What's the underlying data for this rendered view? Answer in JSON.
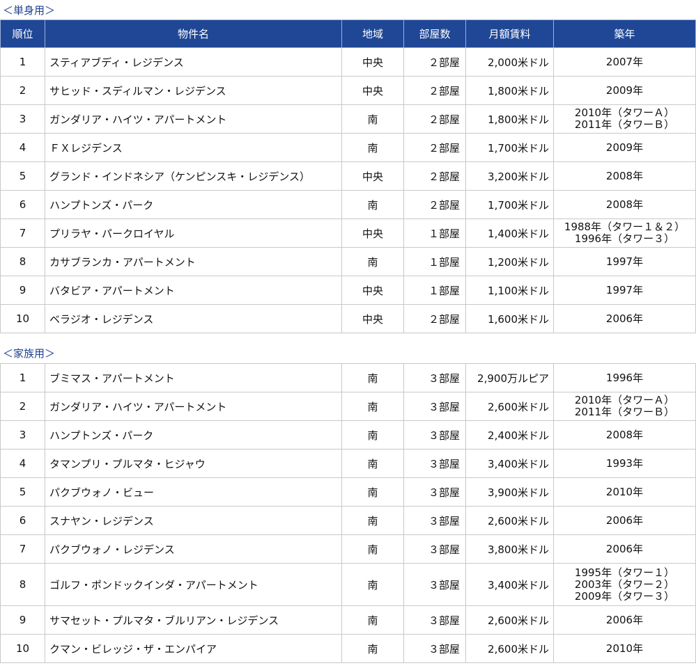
{
  "single": {
    "title": "＜単身用＞",
    "headers": {
      "rank": "順位",
      "name": "物件名",
      "region": "地域",
      "rooms": "部屋数",
      "rent": "月額賃料",
      "year": "築年"
    },
    "rows": [
      {
        "rank": "1",
        "name": "スティアブディ・レジデンス",
        "region": "中央",
        "rooms": "２部屋",
        "rent": "2,000米ドル",
        "year": [
          "2007年"
        ]
      },
      {
        "rank": "2",
        "name": "サヒッド・スディルマン・レジデンス",
        "region": "中央",
        "rooms": "２部屋",
        "rent": "1,800米ドル",
        "year": [
          "2009年"
        ]
      },
      {
        "rank": "3",
        "name": "ガンダリア・ハイツ・アパートメント",
        "region": "南",
        "rooms": "２部屋",
        "rent": "1,800米ドル",
        "year": [
          "2010年（タワーＡ）",
          "2011年（タワーＢ）"
        ]
      },
      {
        "rank": "4",
        "name": "ＦＸレジデンス",
        "region": "南",
        "rooms": "２部屋",
        "rent": "1,700米ドル",
        "year": [
          "2009年"
        ]
      },
      {
        "rank": "5",
        "name": "グランド・インドネシア（ケンピンスキ・レジデンス）",
        "region": "中央",
        "rooms": "２部屋",
        "rent": "3,200米ドル",
        "year": [
          "2008年"
        ]
      },
      {
        "rank": "6",
        "name": "ハンプトンズ・パーク",
        "region": "南",
        "rooms": "２部屋",
        "rent": "1,700米ドル",
        "year": [
          "2008年"
        ]
      },
      {
        "rank": "7",
        "name": "プリラヤ・パークロイヤル",
        "region": "中央",
        "rooms": "１部屋",
        "rent": "1,400米ドル",
        "year": [
          "1988年（タワー１＆２）",
          "1996年（タワー３）"
        ]
      },
      {
        "rank": "8",
        "name": "カサブランカ・アパートメント",
        "region": "南",
        "rooms": "１部屋",
        "rent": "1,200米ドル",
        "year": [
          "1997年"
        ]
      },
      {
        "rank": "9",
        "name": "バタビア・アパートメント",
        "region": "中央",
        "rooms": "１部屋",
        "rent": "1,100米ドル",
        "year": [
          "1997年"
        ]
      },
      {
        "rank": "10",
        "name": "ベラジオ・レジデンス",
        "region": "中央",
        "rooms": "２部屋",
        "rent": "1,600米ドル",
        "year": [
          "2006年"
        ]
      }
    ]
  },
  "family": {
    "title": "＜家族用＞",
    "rows": [
      {
        "rank": "1",
        "name": "ブミマス・アパートメント",
        "region": "南",
        "rooms": "３部屋",
        "rent": "2,900万ルピア",
        "year": [
          "1996年"
        ]
      },
      {
        "rank": "2",
        "name": "ガンダリア・ハイツ・アパートメント",
        "region": "南",
        "rooms": "３部屋",
        "rent": "2,600米ドル",
        "year": [
          "2010年（タワーＡ）",
          "2011年（タワーＢ）"
        ]
      },
      {
        "rank": "3",
        "name": "ハンプトンズ・パーク",
        "region": "南",
        "rooms": "３部屋",
        "rent": "2,400米ドル",
        "year": [
          "2008年"
        ]
      },
      {
        "rank": "4",
        "name": "タマンプリ・プルマタ・ヒジャウ",
        "region": "南",
        "rooms": "３部屋",
        "rent": "3,400米ドル",
        "year": [
          "1993年"
        ]
      },
      {
        "rank": "5",
        "name": "パクブウォノ・ビュー",
        "region": "南",
        "rooms": "３部屋",
        "rent": "3,900米ドル",
        "year": [
          "2010年"
        ]
      },
      {
        "rank": "6",
        "name": "スナヤン・レジデンス",
        "region": "南",
        "rooms": "３部屋",
        "rent": "2,600米ドル",
        "year": [
          "2006年"
        ]
      },
      {
        "rank": "7",
        "name": "パクブウォノ・レジデンス",
        "region": "南",
        "rooms": "３部屋",
        "rent": "3,800米ドル",
        "year": [
          "2006年"
        ]
      },
      {
        "rank": "8",
        "name": "ゴルフ・ポンドックインダ・アパートメント",
        "region": "南",
        "rooms": "３部屋",
        "rent": "3,400米ドル",
        "year": [
          "1995年（タワー１）",
          "2003年（タワー２）",
          "2009年（タワー３）"
        ]
      },
      {
        "rank": "9",
        "name": "サマセット・プルマタ・ブルリアン・レジデンス",
        "region": "南",
        "rooms": "３部屋",
        "rent": "2,600米ドル",
        "year": [
          "2006年"
        ]
      },
      {
        "rank": "10",
        "name": "クマン・ビレッジ・ザ・エンパイア",
        "region": "南",
        "rooms": "３部屋",
        "rent": "2,600米ドル",
        "year": [
          "2010年"
        ]
      }
    ]
  },
  "colors": {
    "header_bg": "#1f4796",
    "section_title": "#1c3f8f"
  }
}
